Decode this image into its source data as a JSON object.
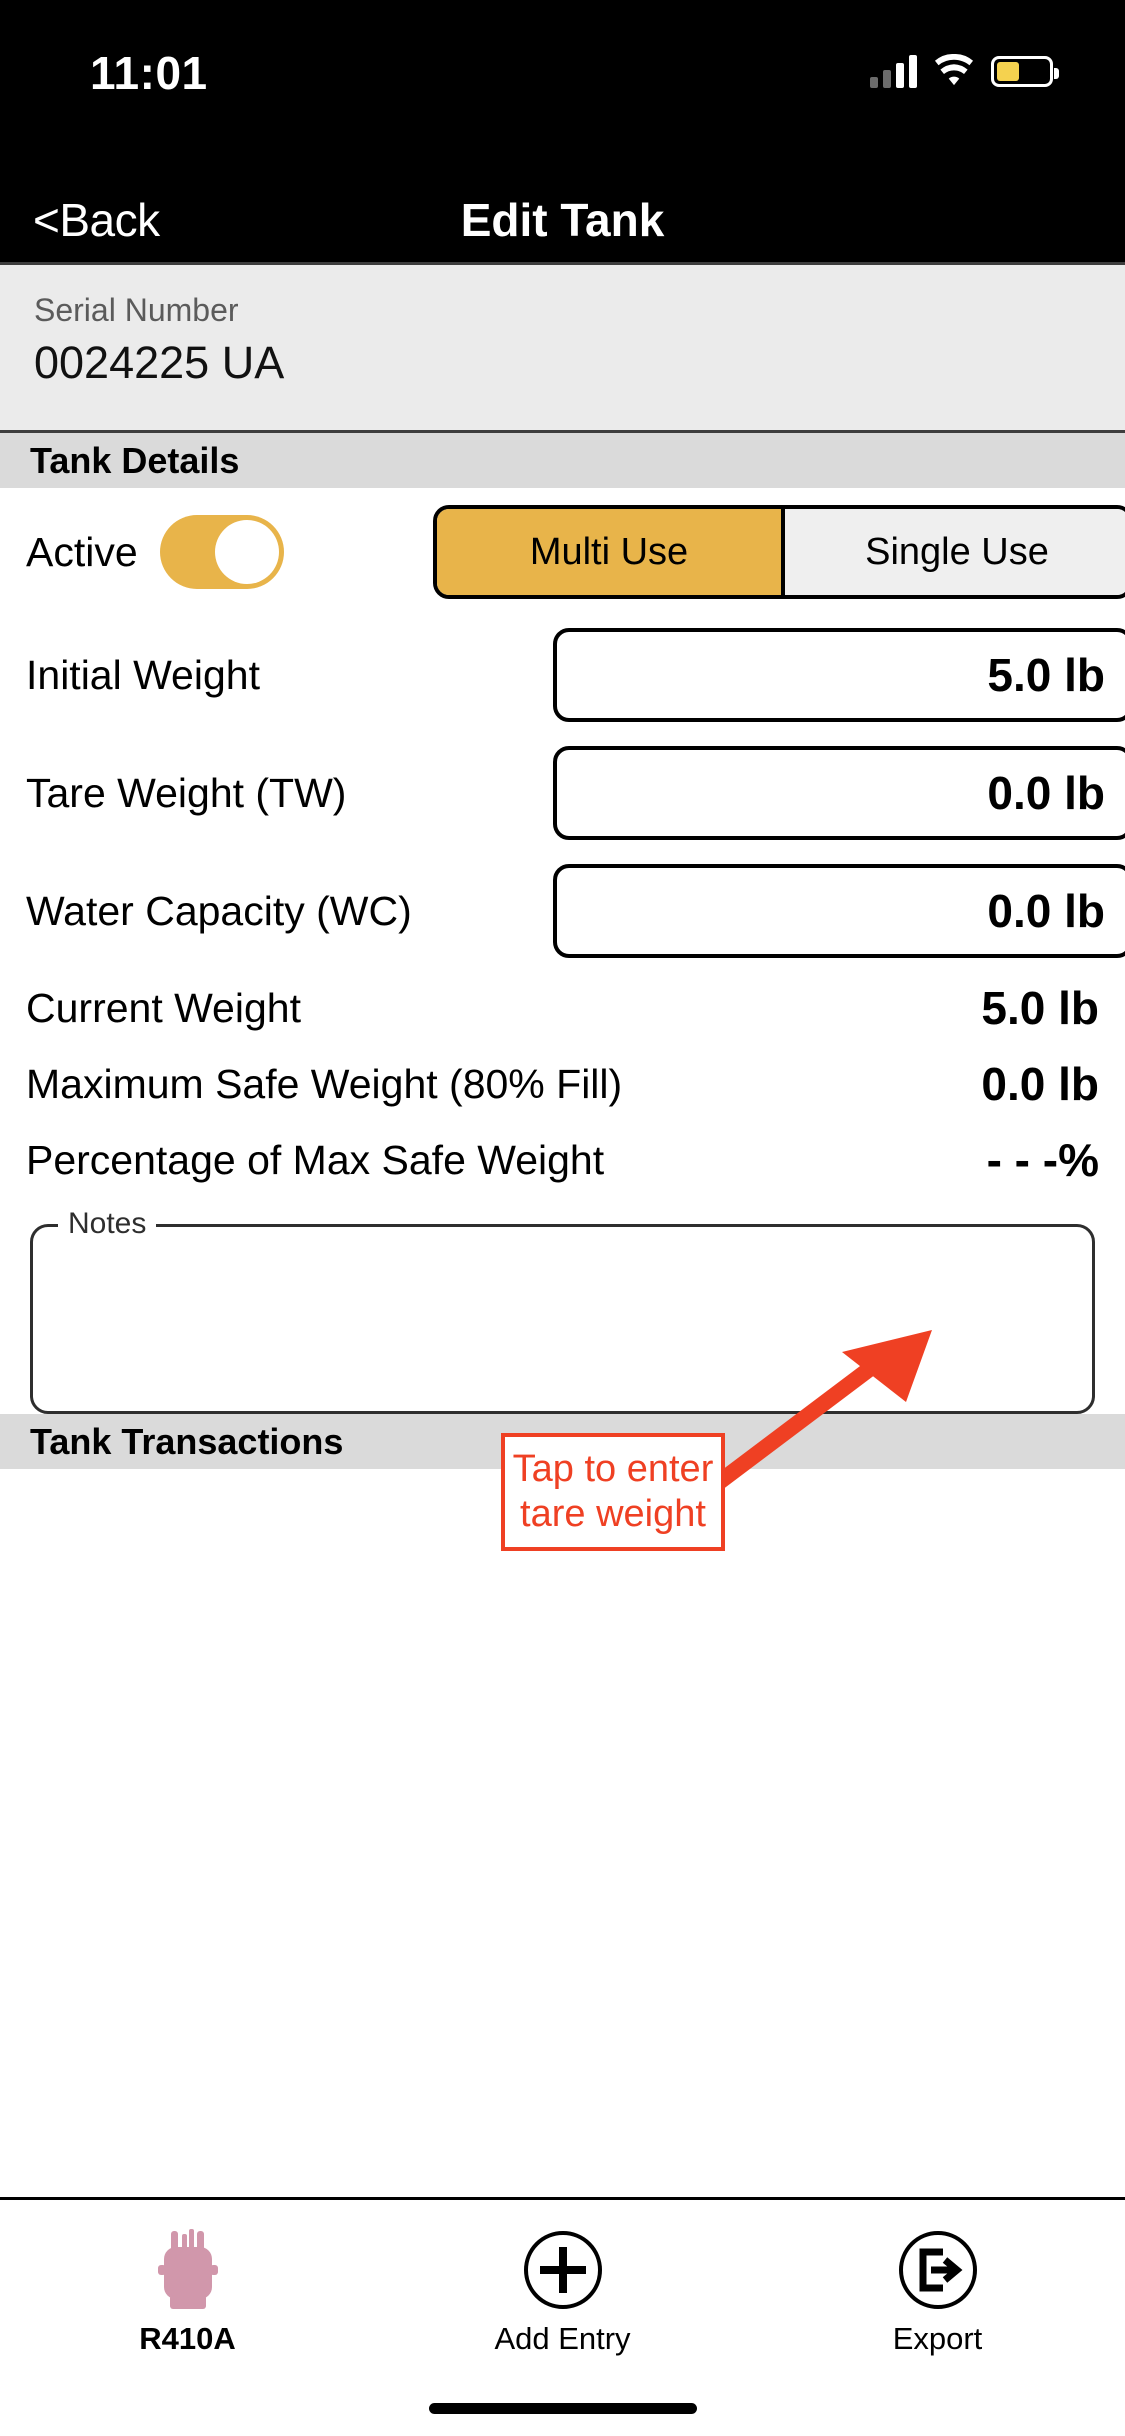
{
  "status_bar": {
    "time": "11:01",
    "signal_icon": "cellular-signal-icon",
    "wifi_icon": "wifi-icon",
    "battery_icon": "battery-icon"
  },
  "nav": {
    "back_label": "<Back",
    "title": "Edit Tank"
  },
  "serial": {
    "label": "Serial Number",
    "value": "0024225 UA"
  },
  "sections": {
    "tank_details": "Tank Details",
    "tank_transactions": "Tank Transactions"
  },
  "tank_details": {
    "active": {
      "label": "Active",
      "state_on": true
    },
    "use_segment": {
      "options": [
        "Multi Use",
        "Single Use"
      ],
      "selected": "Multi Use"
    },
    "fields": [
      {
        "label": "Initial Weight",
        "value": "5.0 lb",
        "editable": true
      },
      {
        "label": "Tare Weight (TW)",
        "value": "0.0 lb",
        "editable": true
      },
      {
        "label": "Water Capacity (WC)",
        "value": "0.0 lb",
        "editable": true
      }
    ],
    "readonly": [
      {
        "label": "Current Weight",
        "value": "5.0 lb"
      },
      {
        "label": "Maximum Safe Weight (80% Fill)",
        "value": "0.0 lb"
      },
      {
        "label": "Percentage of Max Safe Weight",
        "value": "- - -%"
      }
    ],
    "notes": {
      "legend": "Notes",
      "value": "",
      "placeholder": ""
    }
  },
  "annotation": {
    "text_line1": "Tap to enter",
    "text_line2": "tare weight",
    "color": "#ef4023",
    "arrow_icon": "arrow-pointing-up-right-icon"
  },
  "tabbar": {
    "items": [
      {
        "label": "R410A",
        "icon": "refrigerant-tank-icon",
        "active": true
      },
      {
        "label": "Add Entry",
        "icon": "plus-circle-icon",
        "active": false
      },
      {
        "label": "Export",
        "icon": "export-circle-icon",
        "active": false
      }
    ]
  },
  "colors": {
    "accent_amber": "#e8b44a",
    "annotation_red": "#ef4023",
    "tank_icon_pink": "#d197ab",
    "header_black": "#000000"
  }
}
